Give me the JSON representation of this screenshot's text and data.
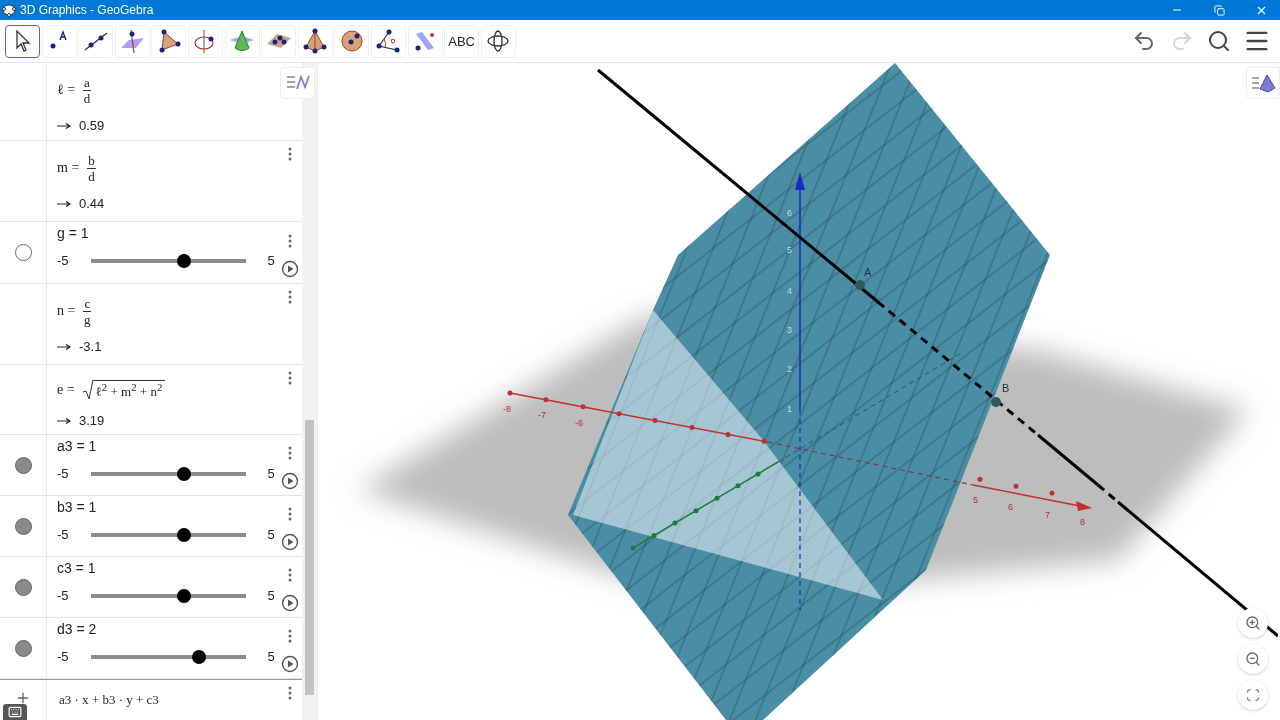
{
  "window": {
    "title": "3D Graphics - GeoGebra"
  },
  "toolbar": {
    "tools": [
      {
        "kind": "move",
        "selected": true
      },
      {
        "kind": "point",
        "selected": false
      },
      {
        "kind": "line",
        "selected": false
      },
      {
        "kind": "perpendicular",
        "selected": false
      },
      {
        "kind": "polygon",
        "selected": false
      },
      {
        "kind": "circle-axis",
        "selected": false
      },
      {
        "kind": "cone",
        "selected": false
      },
      {
        "kind": "plane",
        "selected": false
      },
      {
        "kind": "pyramid",
        "selected": false
      },
      {
        "kind": "sphere",
        "selected": false
      },
      {
        "kind": "angle",
        "selected": false
      },
      {
        "kind": "reflect",
        "selected": false
      },
      {
        "kind": "text",
        "label": "ABC",
        "selected": false
      },
      {
        "kind": "rotate",
        "selected": false
      }
    ],
    "undo": {
      "disabled": false
    },
    "redo": {
      "disabled": true
    }
  },
  "algebra": {
    "items": [
      {
        "kind": "fraction",
        "name": "ℓ =",
        "numerator": "a",
        "denominator": "d",
        "result": "0.59"
      },
      {
        "kind": "fraction",
        "name": "m =",
        "numerator": "b",
        "denominator": "d",
        "result": "0.44"
      },
      {
        "kind": "slider",
        "label": "g = 1",
        "min": "-5",
        "max": "5",
        "level": 0.6,
        "visible": false
      },
      {
        "kind": "fraction",
        "name": "n =",
        "numerator": "c",
        "denominator": "g",
        "result": "-3.1"
      },
      {
        "kind": "root",
        "name": "e =",
        "radicand": "ℓ$^{2}$ + m$^{2}$ + n$^{2}$",
        "result": "3.19"
      },
      {
        "kind": "slider",
        "label": "a3 = 1",
        "min": "-5",
        "max": "5",
        "level": 0.6,
        "visible": true
      },
      {
        "kind": "slider",
        "label": "b3 = 1",
        "min": "-5",
        "max": "5",
        "level": 0.6,
        "visible": true
      },
      {
        "kind": "slider",
        "label": "c3 = 1",
        "min": "-5",
        "max": "5",
        "level": 0.6,
        "visible": true
      },
      {
        "kind": "slider",
        "label": "d3 = 2",
        "min": "-5",
        "max": "5",
        "level": 0.7,
        "visible": true
      }
    ],
    "input": {
      "text": "a3 · x + b3 · y + c3"
    }
  },
  "view": {
    "x_axis_labels": [
      "-8",
      "-7",
      "-6",
      "5",
      "6",
      "7",
      "8"
    ],
    "z_axis_labels": [
      "6",
      "5",
      "4",
      "3",
      "2",
      "1"
    ],
    "points": [
      {
        "label": "A"
      },
      {
        "label": "B"
      }
    ]
  }
}
